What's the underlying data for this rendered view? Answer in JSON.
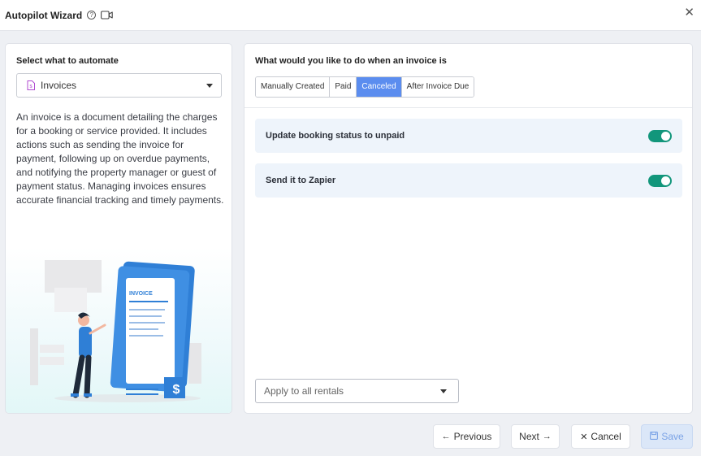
{
  "header": {
    "title": "Autopilot Wizard",
    "help_icon": "question-circle-icon",
    "video_icon": "video-camera-icon",
    "close_icon": "close-icon"
  },
  "left_panel": {
    "label": "Select what to automate",
    "select": {
      "value": "Invoices",
      "icon": "invoice-doc-icon"
    },
    "description": "An invoice is a document detailing the charges for a booking or service provided. It includes actions such as sending the invoice for payment, following up on overdue payments, and notifying the property manager or guest of payment status. Managing invoices ensures accurate financial tracking and timely payments.",
    "illustration": {
      "invoice_label": "INVOICE",
      "currency_symbol": "$"
    }
  },
  "right_panel": {
    "question": "What would you like to do when an invoice is",
    "tabs": [
      {
        "label": "Manually Created",
        "active": false
      },
      {
        "label": "Paid",
        "active": false
      },
      {
        "label": "Canceled",
        "active": true
      },
      {
        "label": "After Invoice Due",
        "active": false
      }
    ],
    "actions": [
      {
        "label": "Update booking status to unpaid",
        "enabled": true
      },
      {
        "label": "Send it to Zapier",
        "enabled": true
      }
    ],
    "apply_select": {
      "value": "Apply to all rentals"
    }
  },
  "footer": {
    "previous": "Previous",
    "next": "Next",
    "cancel": "Cancel",
    "save": "Save"
  },
  "colors": {
    "accent": "#5b8def",
    "toggle_on": "#12967b",
    "action_bg": "#eef4fb",
    "save_bg": "#dbe7f8"
  }
}
